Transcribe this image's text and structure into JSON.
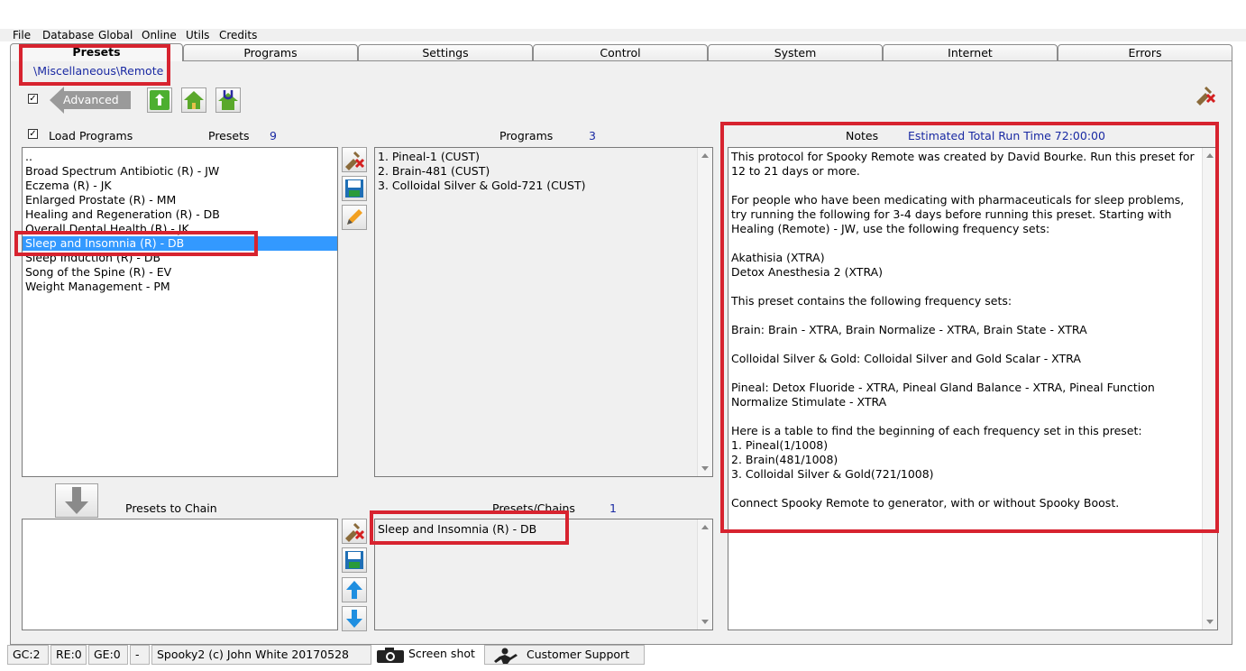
{
  "menu": [
    "File",
    "Database",
    "Global",
    "Online",
    "Utils",
    "Credits"
  ],
  "tabs": [
    "Presets",
    "Programs",
    "Settings",
    "Control",
    "System",
    "Internet",
    "Errors"
  ],
  "path": "\\Miscellaneous\\Remote",
  "advanced": {
    "checked": true,
    "label": "Advanced"
  },
  "load_programs": {
    "checked": true,
    "label": "Load Programs"
  },
  "presets": {
    "label": "Presets",
    "count": "9",
    "items": [
      "..",
      "Broad Spectrum Antibiotic (R) - JW",
      "Eczema (R) - JK",
      "Enlarged Prostate (R) - MM",
      "Healing and Regeneration (R) - DB",
      "Overall Dental Health (R) - JK",
      "Sleep and Insomnia (R) - DB",
      "Sleep Induction (R) - DB",
      "Song of the Spine (R) - EV",
      "Weight Management - PM"
    ],
    "selected_index": 6
  },
  "programs": {
    "label": "Programs",
    "count": "3",
    "items": [
      "1. Pineal-1 (CUST)",
      "2. Brain-481 (CUST)",
      "3. Colloidal Silver & Gold-721 (CUST)"
    ]
  },
  "notes": {
    "label": "Notes",
    "runtime": "Estimated Total Run Time 72:00:00",
    "text": "This protocol for Spooky Remote was created by David Bourke. Run this preset for 12 to 21 days or more.\n\nFor people who have been medicating with pharmaceuticals for sleep problems, try running the following for 3-4 days before running this preset. Starting with Healing (Remote) - JW, use the following frequency sets:\n\nAkathisia (XTRA)\nDetox Anesthesia 2 (XTRA)\n\nThis preset contains the following frequency sets:\n\nBrain: Brain - XTRA, Brain Normalize - XTRA, Brain State - XTRA\n\nColloidal Silver & Gold: Colloidal Silver and Gold Scalar - XTRA\n\nPineal: Detox Fluoride - XTRA, Pineal Gland Balance - XTRA, Pineal Function Normalize Stimulate - XTRA\n\nHere is a table to find the beginning of each frequency set in this preset:\n1. Pineal(1/1008)\n2. Brain(481/1008)\n3. Colloidal Silver & Gold(721/1008)\n\nConnect Spooky Remote to generator, with or without Spooky Boost."
  },
  "chain": {
    "label": "Presets to Chain",
    "presets_chains_label": "Presets/Chains",
    "presets_chains_count": "1",
    "items": [
      "Sleep and Insomnia (R) - DB"
    ]
  },
  "status": {
    "gc": "GC:2",
    "re": "RE:0",
    "ge": "GE:0",
    "dash": "-",
    "version": "Spooky2 (c) John White 20170528",
    "screenshot": "Screen shot",
    "support": "Customer Support"
  }
}
